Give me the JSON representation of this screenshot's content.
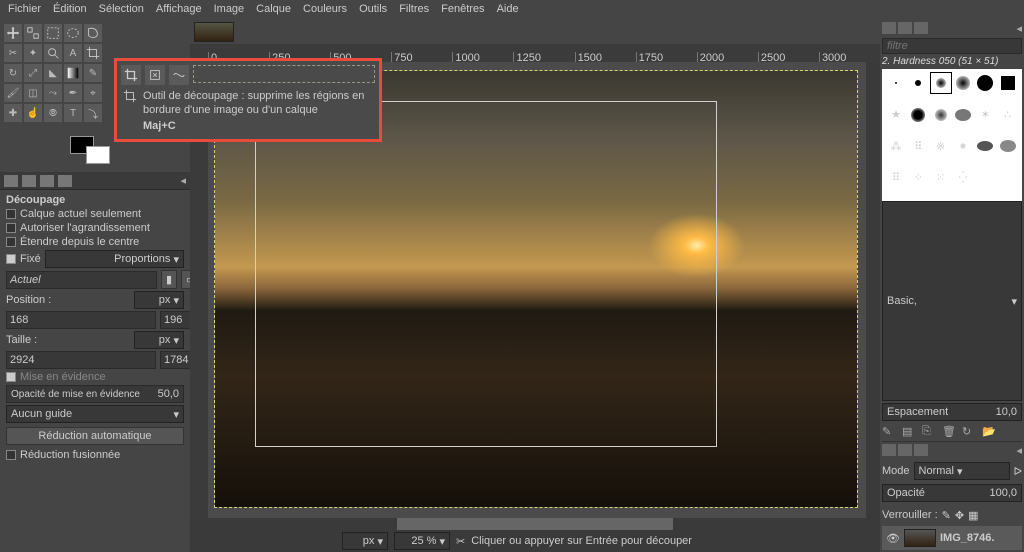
{
  "menubar": [
    "Fichier",
    "Édition",
    "Sélection",
    "Affichage",
    "Image",
    "Calque",
    "Couleurs",
    "Outils",
    "Filtres",
    "Fenêtres",
    "Aide"
  ],
  "tooltip": {
    "title": "Outil de découpage : supprime les régions en bordure d'une image ou d'un calque",
    "shortcut": "Maj+C"
  },
  "crop_options": {
    "heading": "Découpage",
    "cb1": "Calque actuel seulement",
    "cb2": "Autoriser l'agrandissement",
    "cb3": "Étendre depuis le centre",
    "fixed_label": "Fixé",
    "fixed_dropdown": "Proportions",
    "aspect_value": "Actuel",
    "position_label": "Position :",
    "position_unit": "px",
    "pos_x": "168",
    "pos_y": "196",
    "size_label": "Taille :",
    "size_unit": "px",
    "size_w": "2924",
    "size_h": "1784",
    "highlight_label": "Mise en évidence",
    "highlight_inner": "Opacité de mise en évidence",
    "highlight_val": "50,0",
    "guide": "Aucun guide",
    "btn_auto": "Réduction automatique",
    "cb_merged": "Réduction fusionnée"
  },
  "ruler_h": [
    "0",
    "250",
    "500",
    "750",
    "1000",
    "1250",
    "1500",
    "1750",
    "2000",
    "2500",
    "3000"
  ],
  "status": {
    "unit": "px",
    "zoom": "25 %",
    "msg": "Cliquer ou appuyer sur Entrée pour découper"
  },
  "right": {
    "filter_placeholder": "filtre",
    "brush_title": "2. Hardness 050 (51 × 51)",
    "preset": "Basic,",
    "spacing_label": "Espacement",
    "spacing_val": "10,0",
    "mode_label": "Mode",
    "mode_val": "Normal",
    "opacity_label": "Opacité",
    "opacity_val": "100,0",
    "lock_label": "Verrouiller :",
    "layer_name": "IMG_8746."
  }
}
